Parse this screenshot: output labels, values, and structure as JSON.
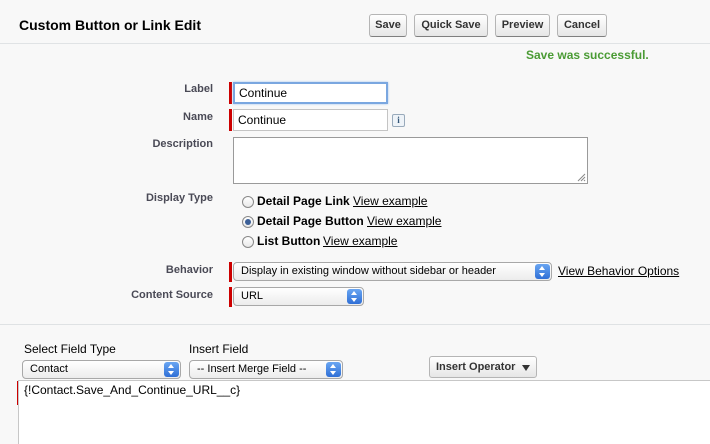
{
  "header": {
    "title": "Custom Button or Link Edit",
    "buttons": {
      "save": "Save",
      "quick_save": "Quick Save",
      "preview": "Preview",
      "cancel": "Cancel"
    }
  },
  "status": {
    "message": "Save was successful.",
    "color": "#4a9b34"
  },
  "fields": {
    "label": {
      "label": "Label",
      "value": "Continue"
    },
    "name": {
      "label": "Name",
      "value": "Continue",
      "info_icon": "info-icon"
    },
    "description": {
      "label": "Description",
      "value": ""
    },
    "display_type": {
      "label": "Display Type",
      "options": [
        {
          "label": "Detail Page Link",
          "link": "View example",
          "checked": false
        },
        {
          "label": "Detail Page Button",
          "link": "View example",
          "checked": true
        },
        {
          "label": "List Button",
          "link": "View example",
          "checked": false
        }
      ]
    },
    "behavior": {
      "label": "Behavior",
      "value": "Display in existing window without sidebar or header",
      "link": "View Behavior Options"
    },
    "content_source": {
      "label": "Content Source",
      "value": "URL"
    }
  },
  "insert": {
    "field_type_label": "Select Field Type",
    "field_type_value": "Contact",
    "insert_field_label": "Insert Field",
    "insert_field_value": "-- Insert Merge Field --",
    "operator_label": "Insert Operator"
  },
  "formula": {
    "text": "{!Contact.Save_And_Continue_URL__c}"
  },
  "colors": {
    "required": "#cc0000",
    "focus": "#7aa7e0",
    "select_arrow": "#2f6fd6"
  }
}
